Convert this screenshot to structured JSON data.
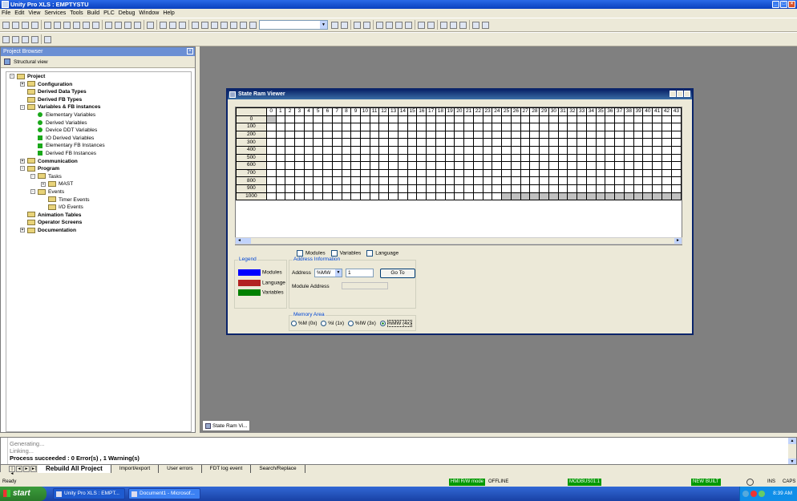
{
  "app": {
    "title": "Unity Pro XLS : EMPTYSTU"
  },
  "menu": [
    "File",
    "Edit",
    "View",
    "Services",
    "Tools",
    "Build",
    "PLC",
    "Debug",
    "Window",
    "Help"
  ],
  "project_browser": {
    "title": "Project Browser",
    "view_tab": "Structural view",
    "tree": [
      {
        "label": "Project",
        "level": 0,
        "bold": true,
        "exp": "-",
        "icon": "folder"
      },
      {
        "label": "Configuration",
        "level": 1,
        "bold": true,
        "exp": "+",
        "icon": "folder"
      },
      {
        "label": "Derived Data Types",
        "level": 1,
        "bold": true,
        "exp": "",
        "icon": "folder"
      },
      {
        "label": "Derived FB Types",
        "level": 1,
        "bold": true,
        "exp": "",
        "icon": "folder"
      },
      {
        "label": "Variables & FB instances",
        "level": 1,
        "bold": true,
        "exp": "-",
        "icon": "folder"
      },
      {
        "label": "Elementary Variables",
        "level": 2,
        "bold": false,
        "exp": "",
        "icon": "dot"
      },
      {
        "label": "Derived Variables",
        "level": 2,
        "bold": false,
        "exp": "",
        "icon": "dot"
      },
      {
        "label": "Device DDT Variables",
        "level": 2,
        "bold": false,
        "exp": "",
        "icon": "dot"
      },
      {
        "label": "IO Derived Variables",
        "level": 2,
        "bold": false,
        "exp": "",
        "icon": "sq"
      },
      {
        "label": "Elementary FB Instances",
        "level": 2,
        "bold": false,
        "exp": "",
        "icon": "sq"
      },
      {
        "label": "Derived FB Instances",
        "level": 2,
        "bold": false,
        "exp": "",
        "icon": "sq"
      },
      {
        "label": "Communication",
        "level": 1,
        "bold": true,
        "exp": "+",
        "icon": "folder"
      },
      {
        "label": "Program",
        "level": 1,
        "bold": true,
        "exp": "-",
        "icon": "folder"
      },
      {
        "label": "Tasks",
        "level": 2,
        "bold": false,
        "exp": "-",
        "icon": "folder"
      },
      {
        "label": "MAST",
        "level": 3,
        "bold": false,
        "exp": "+",
        "icon": "folder"
      },
      {
        "label": "Events",
        "level": 2,
        "bold": false,
        "exp": "-",
        "icon": "folder"
      },
      {
        "label": "Timer Events",
        "level": 3,
        "bold": false,
        "exp": "",
        "icon": "folder"
      },
      {
        "label": "I/O Events",
        "level": 3,
        "bold": false,
        "exp": "",
        "icon": "folder"
      },
      {
        "label": "Animation Tables",
        "level": 1,
        "bold": true,
        "exp": "",
        "icon": "folder"
      },
      {
        "label": "Operator Screens",
        "level": 1,
        "bold": true,
        "exp": "",
        "icon": "folder"
      },
      {
        "label": "Documentation",
        "level": 1,
        "bold": true,
        "exp": "+",
        "icon": "folder"
      }
    ]
  },
  "viewer": {
    "title": "State Ram Viewer",
    "columns": [
      "0",
      "1",
      "2",
      "3",
      "4",
      "5",
      "6",
      "7",
      "8",
      "9",
      "10",
      "11",
      "12",
      "13",
      "14",
      "15",
      "16",
      "17",
      "18",
      "19",
      "20",
      "21",
      "22",
      "23",
      "24",
      "25",
      "26",
      "27",
      "28",
      "29",
      "30",
      "31",
      "32",
      "33",
      "34",
      "35",
      "36",
      "37",
      "38",
      "39",
      "40",
      "41",
      "42",
      "43"
    ],
    "rows": [
      "0",
      "100",
      "200",
      "300",
      "400",
      "500",
      "600",
      "700",
      "800",
      "900",
      "1000"
    ],
    "checks": {
      "modules": "Modules",
      "variables": "Variables",
      "language": "Language"
    },
    "legend": {
      "title": "Legend",
      "modules": "Modules",
      "language": "Language",
      "variables": "Variables",
      "colors": {
        "modules": "#0000ff",
        "language": "#b22222",
        "variables": "#008000"
      }
    },
    "address": {
      "title": "Address Information",
      "label": "Address",
      "type": "%MW",
      "value": "1",
      "goto": "Go To",
      "module_label": "Module Address"
    },
    "memory": {
      "title": "Memory Area",
      "options": [
        "%M (0x)",
        "%I (1x)",
        "%IW (3x)",
        "%MW (4x)"
      ],
      "selected": "%MW (4x)"
    }
  },
  "mdi_tab": "State Ram Vi...",
  "output": {
    "lines": [
      "Generating...",
      "Linking...",
      "Process succeeded  : 0 Error(s) , 1 Warning(s)"
    ],
    "tabs": [
      "Rebuild All Project",
      "Import/export",
      "User errors",
      "FDT log event",
      "Search/Replace"
    ]
  },
  "status": {
    "ready": "Ready",
    "hmi": "HMI R/W mode",
    "offline": "OFFLINE",
    "modbus": "MODBUS01:1",
    "new": "NEW",
    "built": "BUILT",
    "ins": "INS",
    "caps": "CAPS"
  },
  "taskbar": {
    "start": "start",
    "tasks": [
      "Unity Pro XLS : EMPT...",
      "Document1 - Microsof..."
    ],
    "clock": "8:39 AM"
  }
}
